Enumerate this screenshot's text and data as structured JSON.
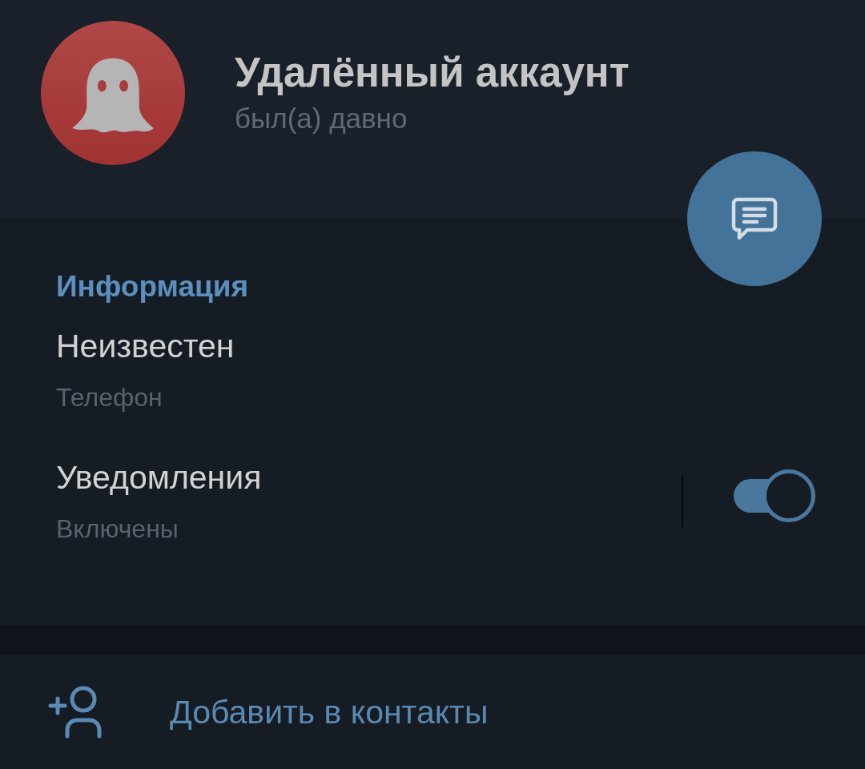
{
  "profile": {
    "name": "Удалённый аккаунт",
    "status": "был(а) давно"
  },
  "info": {
    "title": "Информация",
    "phone": {
      "value": "Неизвестен",
      "label": "Телефон"
    },
    "notifications": {
      "title": "Уведомления",
      "value": "Включены",
      "on": true
    }
  },
  "add_contact": {
    "label": "Добавить в контакты"
  }
}
